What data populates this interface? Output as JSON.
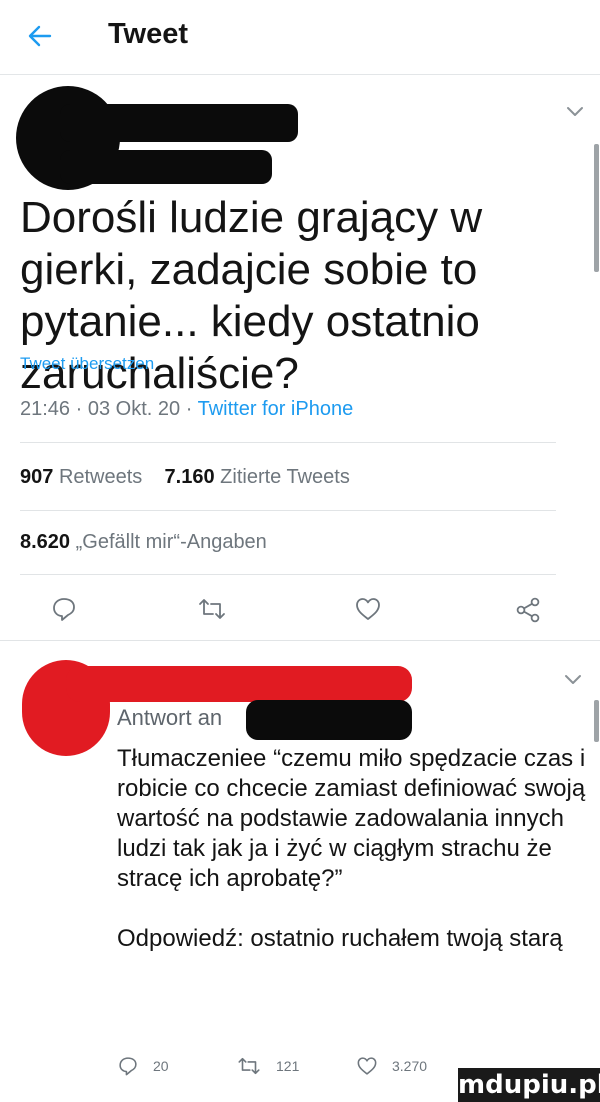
{
  "header": {
    "title": "Tweet"
  },
  "tweet": {
    "text": "Dorośli ludzie grający w gierki, zadajcie sobie to pytanie... kiedy ostatnio zaruchaliście?",
    "translate_label": "Tweet übersetzen",
    "time": "21:46",
    "date": "03 Okt. 20",
    "separator": "·",
    "source": "Twitter for iPhone",
    "retweets_count": "907",
    "retweets_label": "Retweets",
    "quotes_count": "7.160",
    "quotes_label": "Zitierte Tweets",
    "likes_count": "8.620",
    "likes_label": "„Gefällt mir“-Angaben"
  },
  "reply": {
    "reply_to_label": "Antwort an",
    "text": "Tłumaczeniee “czemu miło spędzacie czas i robicie co chcecie zamiast definiować swoją wartość na podstawie zadowalania innych ludzi tak jak ja i żyć w ciągłym strachu że stracę ich aprobatę?”\n\nOdpowiedź: ostatnio ruchałem twoją starą",
    "replies_count": "20",
    "retweets_count": "121",
    "likes_count": "3.270"
  },
  "watermark": {
    "text": "mdupiu.pl"
  },
  "colors": {
    "accent": "#1d9bf0",
    "muted": "#6e767d",
    "text": "#141414",
    "divider": "#e1e4e6"
  },
  "icons": [
    "back-arrow-icon",
    "chevron-down-icon",
    "reply-icon",
    "retweet-icon",
    "like-icon",
    "share-icon"
  ]
}
